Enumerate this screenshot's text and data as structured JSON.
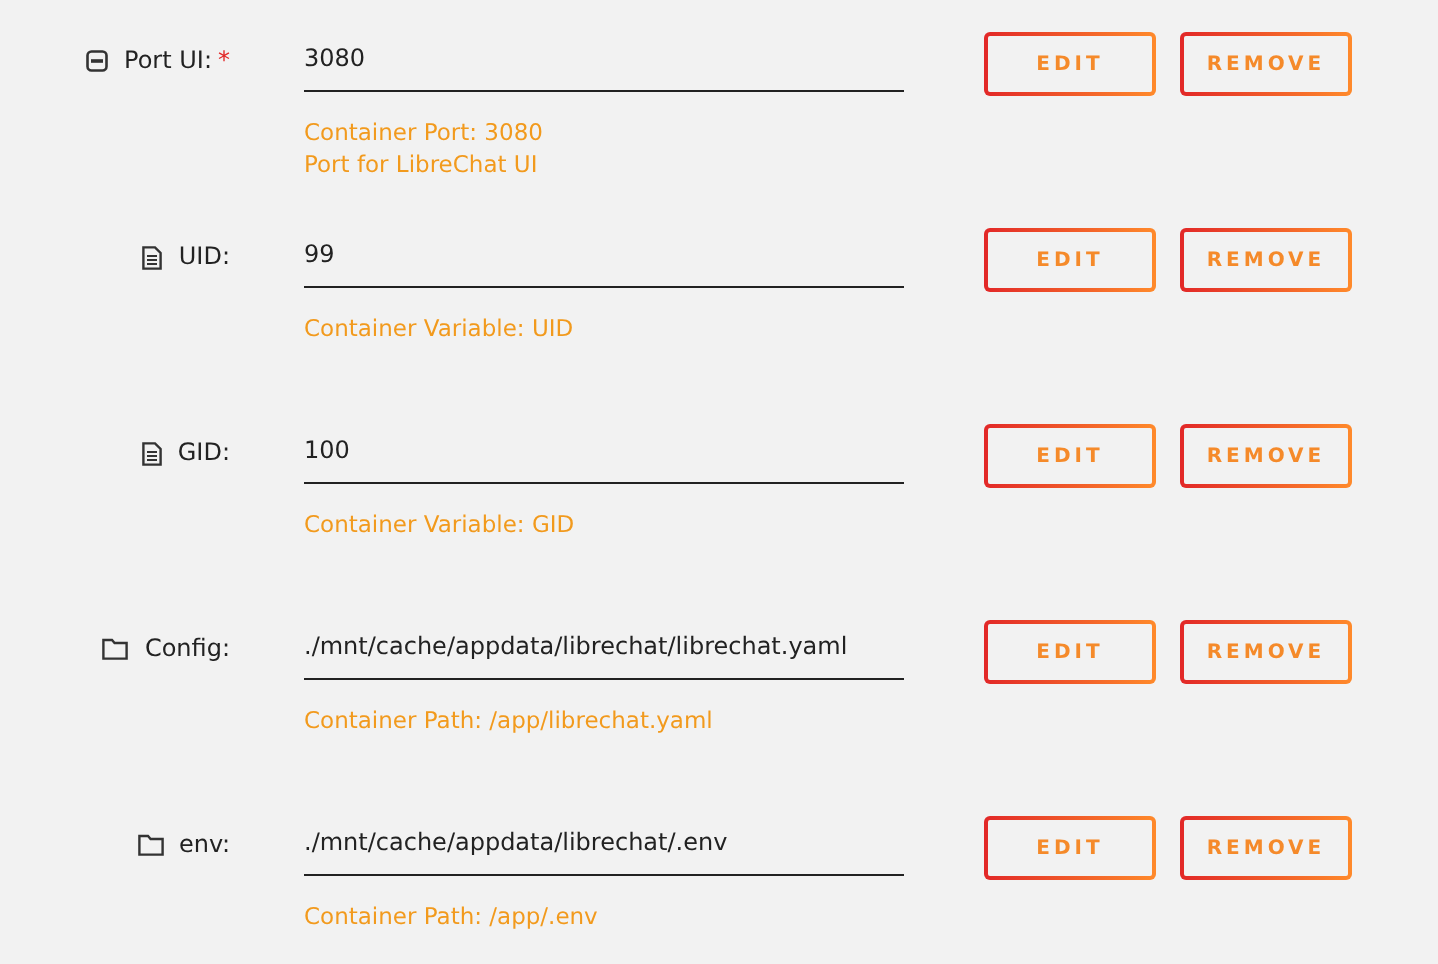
{
  "fields": [
    {
      "kind": "port",
      "label": "Port UI:",
      "marker": "*",
      "value": "3080",
      "notes": [
        "Container Port: 3080",
        "Port for LibreChat UI"
      ],
      "buttons": [
        "EDIT",
        "REMOVE"
      ]
    },
    {
      "kind": "variable",
      "label": "UID:",
      "value": "99",
      "notes": [
        "Container Variable: UID"
      ],
      "buttons": [
        "EDIT",
        "REMOVE"
      ]
    },
    {
      "kind": "variable",
      "label": "GID:",
      "value": "100",
      "notes": [
        "Container Variable: GID"
      ],
      "buttons": [
        "EDIT",
        "REMOVE"
      ]
    },
    {
      "kind": "path",
      "label": "Config:",
      "value": "./mnt/cache/appdata/librechat/librechat.yaml",
      "notes": [
        "Container Path: /app/librechat.yaml"
      ],
      "buttons": [
        "EDIT",
        "REMOVE"
      ]
    },
    {
      "kind": "path",
      "label": "env:",
      "value": "./mnt/cache/appdata/librechat/.env",
      "notes": [
        "Container Path: /app/.env"
      ],
      "buttons": [
        "EDIT",
        "REMOVE"
      ]
    }
  ]
}
